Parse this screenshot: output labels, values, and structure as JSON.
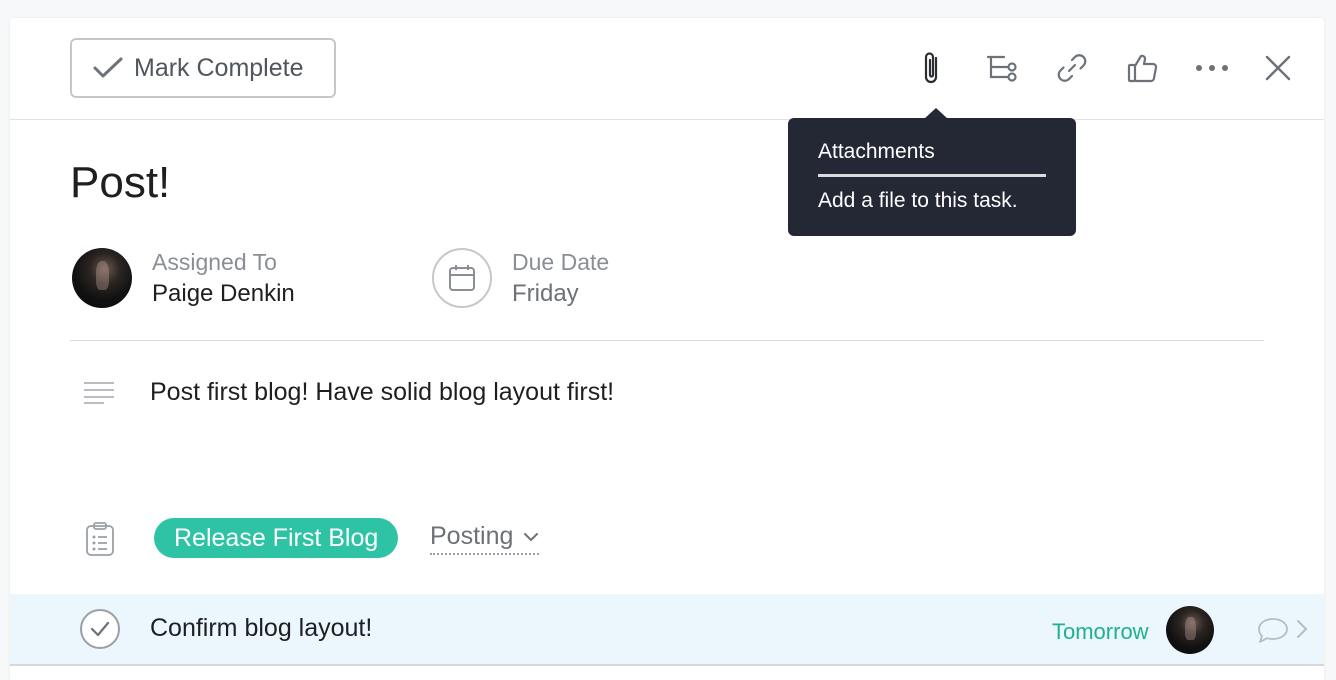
{
  "toolbar": {
    "mark_complete_label": "Mark Complete",
    "icons": [
      "paperclip-icon",
      "subtasks-icon",
      "link-icon",
      "thumbs-up-icon",
      "more-icon",
      "close-icon"
    ]
  },
  "tooltip": {
    "title": "Attachments",
    "body": "Add a file to this task."
  },
  "task": {
    "title": "Post!",
    "assigned_label": "Assigned To",
    "assignee": "Paige Denkin",
    "due_label": "Due Date",
    "due_value": "Friday",
    "description": "Post first blog! Have solid blog layout first!",
    "project": "Release First Blog",
    "section": "Posting"
  },
  "subtask": {
    "text": "Confirm blog layout!",
    "due": "Tomorrow"
  },
  "colors": {
    "project_pill": "#2fc3a5",
    "due_green": "#1fb08c",
    "tooltip_bg": "#232834",
    "subtask_highlight": "#ebf6fd"
  }
}
